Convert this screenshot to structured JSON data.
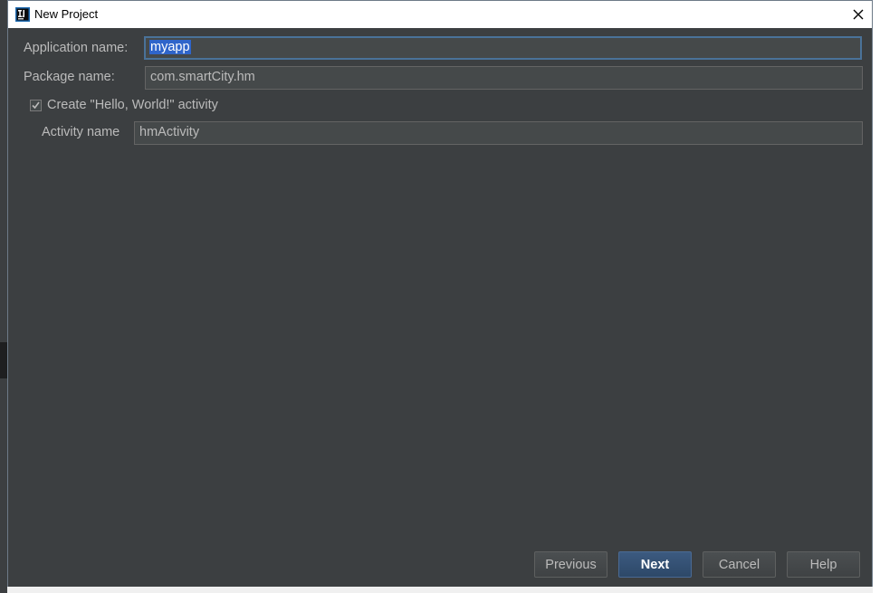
{
  "window": {
    "title": "New Project"
  },
  "form": {
    "application_name": {
      "label": "Application name:",
      "value": "myapp"
    },
    "package_name": {
      "label": "Package name:",
      "value": "com.smartCity.hm"
    },
    "create_activity": {
      "label": "Create \"Hello, World!\" activity",
      "checked": true
    },
    "activity_name": {
      "label": "Activity name",
      "value": "hmActivity"
    }
  },
  "buttons": {
    "previous": "Previous",
    "next": "Next",
    "cancel": "Cancel",
    "help": "Help"
  },
  "colors": {
    "dialog_bg": "#3c3f41",
    "field_bg": "#45494a",
    "focus_border": "#4a7299",
    "selection": "#2f65ca",
    "text": "#bbbbbb"
  },
  "icons": {
    "app": "intellij-idea-icon",
    "close": "close-icon",
    "checkmark": "checkmark-icon"
  }
}
